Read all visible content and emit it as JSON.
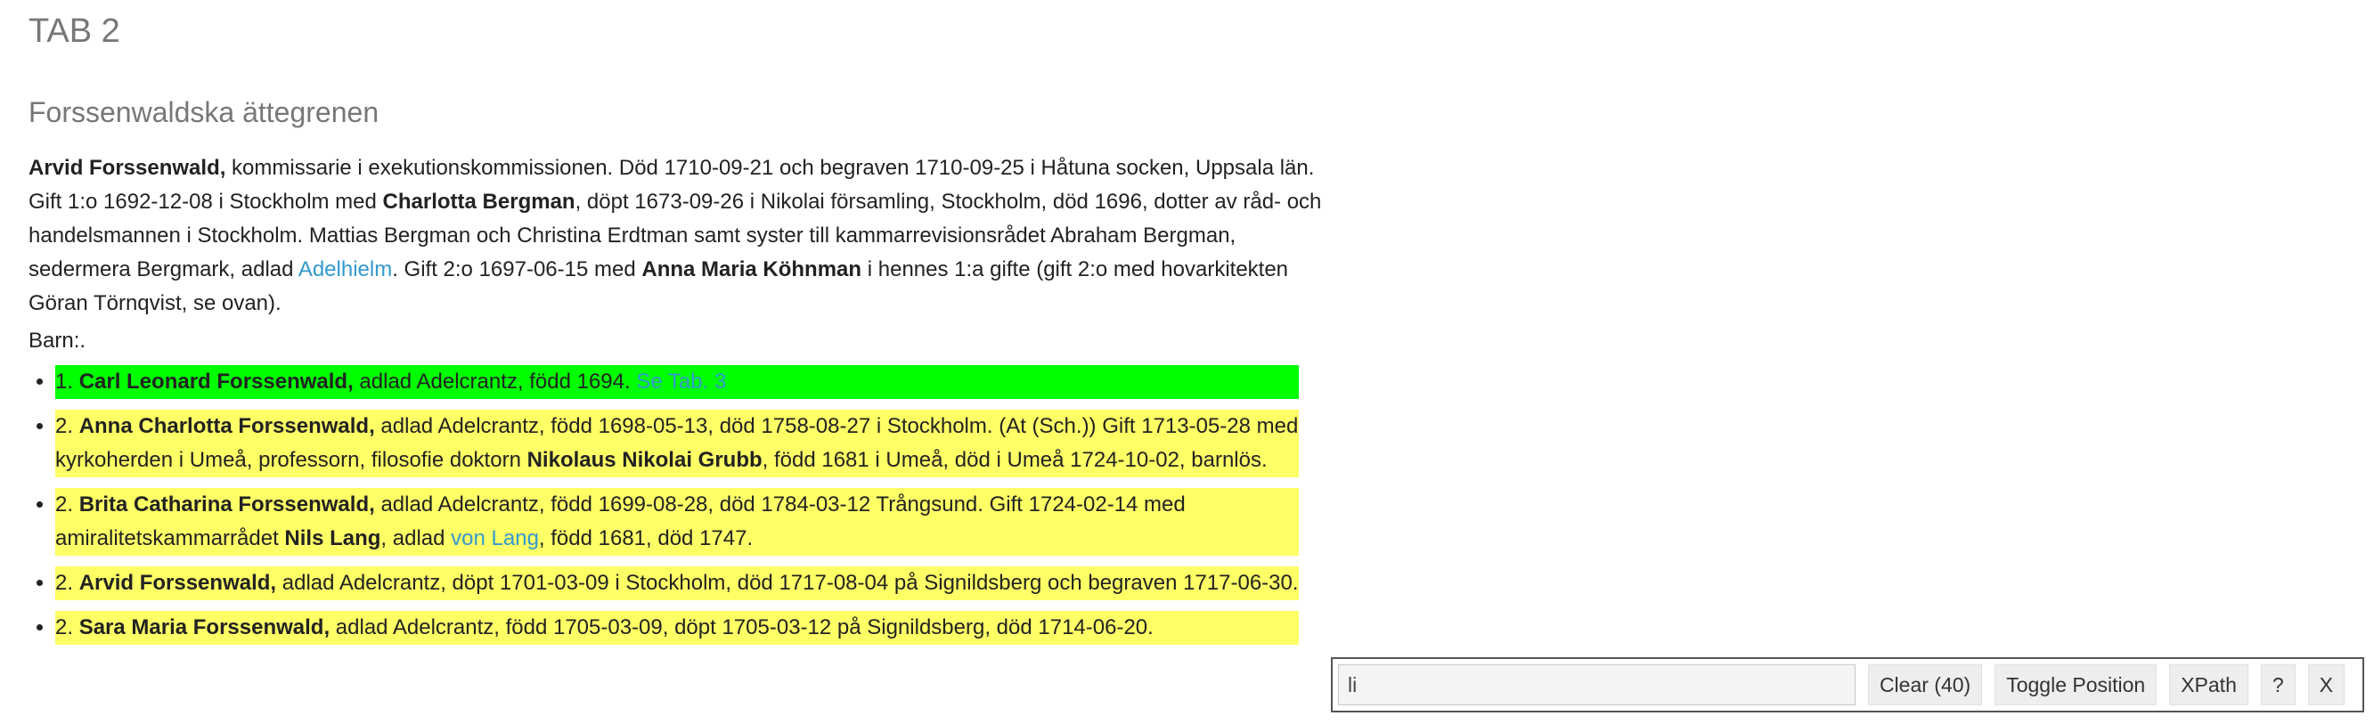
{
  "heading": {
    "tab_title": "TAB 2",
    "subtitle": "Forssenwaldska ättegrenen"
  },
  "intro": {
    "name1": "Arvid Forssenwald,",
    "t1": " kommissarie i exekutionskommissionen. Död 1710-09-21 och begraven 1710-09-25 i Håtuna socken, Uppsala län. Gift 1:o 1692-12-08 i Stockholm med ",
    "name2": "Charlotta Bergman",
    "t2": ", döpt 1673-09-26 i Nikolai församling, Stockholm, död 1696, dotter av råd- och handelsmannen i Stockholm. Mattias Bergman och Christina Erdtman samt syster till kammarrevisionsrådet Abraham Bergman, sedermera Bergmark, adlad ",
    "link1": "Adelhielm",
    "t3": ". Gift 2:o 1697-06-15 med ",
    "name3": "Anna Maria Köhnman",
    "t4": " i hennes 1:a gifte (gift 2:o med hovarkitekten Göran Törnqvist, se ovan)."
  },
  "barn_label": "Barn:.",
  "children": [
    {
      "num": "1. ",
      "name": "Carl Leonard Forssenwald,",
      "text": " adlad Adelcrantz, född 1694. ",
      "link": "Se Tab. 3"
    },
    {
      "num": "2. ",
      "name": "Anna Charlotta Forssenwald,",
      "text": " adlad Adelcrantz, född 1698-05-13, död 1758-08-27 i Stockholm. (At (Sch.)) Gift 1713-05-28 med kyrkoherden i Umeå, professorn, filosofie doktorn ",
      "name2": "Nikolaus Nikolai Grubb",
      "text2": ", född 1681 i Umeå, död i Umeå 1724-10-02, barnlös."
    },
    {
      "num": "2. ",
      "name": "Brita Catharina Forssenwald,",
      "text": " adlad Adelcrantz, född 1699-08-28, död 1784-03-12 Trångsund. Gift 1724-02-14 med amiralitetskammarrådet ",
      "name2": "Nils Lang",
      "text2": ", adlad ",
      "link": "von Lang",
      "text3": ", född 1681, död 1747."
    },
    {
      "num": "2. ",
      "name": "Arvid Forssenwald,",
      "text": " adlad Adelcrantz, döpt 1701-03-09 i Stockholm, död 1717-08-04 på Signildsberg och begraven 1717-06-30."
    },
    {
      "num": "2. ",
      "name": "Sara Maria Forssenwald,",
      "text": " adlad Adelcrantz, född 1705-03-09, döpt 1705-03-12 på Signildsberg, död 1714-06-20."
    }
  ],
  "search_tool": {
    "query_value": "li",
    "clear_label": "Clear (40)",
    "toggle_label": "Toggle Position",
    "xpath_label": "XPath",
    "help_label": "?",
    "close_label": "X"
  },
  "colors": {
    "highlight_current": "#00ff00",
    "highlight_match": "#ffff66",
    "link": "#3399cc",
    "heading": "#777777"
  }
}
